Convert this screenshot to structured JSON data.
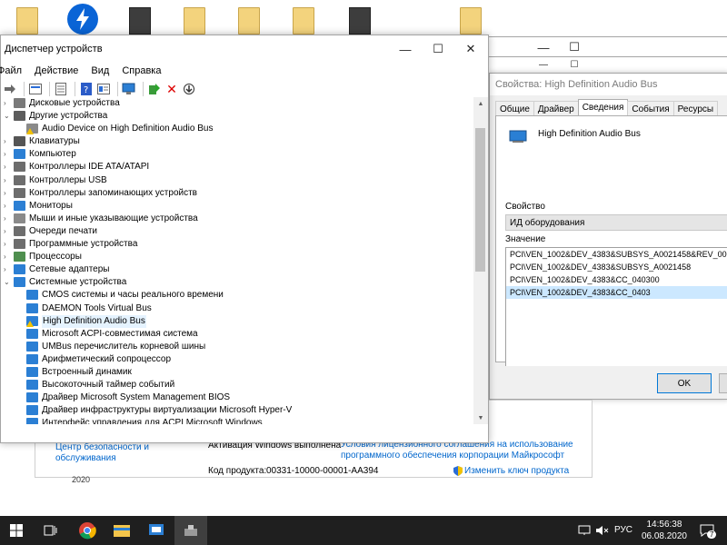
{
  "device_manager": {
    "title": "Диспетчер устройств",
    "menu": [
      "Файл",
      "Действие",
      "Вид",
      "Справка"
    ],
    "tree": [
      {
        "label": "Дисковые устройства",
        "level": 0,
        "state": "collapsed",
        "icon": "disk-icon"
      },
      {
        "label": "Другие устройства",
        "level": 0,
        "state": "expanded",
        "icon": "other-devices-icon"
      },
      {
        "label": "Audio Device on High Definition Audio Bus",
        "level": 1,
        "state": "leaf",
        "icon": "unknown-device-warning-icon"
      },
      {
        "label": "Клавиатуры",
        "level": 0,
        "state": "collapsed",
        "icon": "keyboard-icon"
      },
      {
        "label": "Компьютер",
        "level": 0,
        "state": "collapsed",
        "icon": "computer-icon"
      },
      {
        "label": "Контроллеры IDE ATA/ATAPI",
        "level": 0,
        "state": "collapsed",
        "icon": "ide-controller-icon"
      },
      {
        "label": "Контроллеры USB",
        "level": 0,
        "state": "collapsed",
        "icon": "usb-icon"
      },
      {
        "label": "Контроллеры запоминающих устройств",
        "level": 0,
        "state": "collapsed",
        "icon": "storage-controller-icon"
      },
      {
        "label": "Мониторы",
        "level": 0,
        "state": "collapsed",
        "icon": "monitor-icon"
      },
      {
        "label": "Мыши и иные указывающие устройства",
        "level": 0,
        "state": "collapsed",
        "icon": "mouse-icon"
      },
      {
        "label": "Очереди печати",
        "level": 0,
        "state": "collapsed",
        "icon": "printer-icon"
      },
      {
        "label": "Программные устройства",
        "level": 0,
        "state": "collapsed",
        "icon": "software-device-icon"
      },
      {
        "label": "Процессоры",
        "level": 0,
        "state": "collapsed",
        "icon": "processor-icon"
      },
      {
        "label": "Сетевые адаптеры",
        "level": 0,
        "state": "collapsed",
        "icon": "network-adapter-icon"
      },
      {
        "label": "Системные устройства",
        "level": 0,
        "state": "expanded",
        "icon": "system-device-icon"
      },
      {
        "label": "CMOS системы и часы реального времени",
        "level": 1,
        "state": "leaf",
        "icon": "system-device-icon"
      },
      {
        "label": "DAEMON Tools Virtual Bus",
        "level": 1,
        "state": "leaf",
        "icon": "system-device-icon"
      },
      {
        "label": "High Definition Audio Bus",
        "level": 1,
        "state": "leaf",
        "icon": "system-device-warning-icon",
        "selected": true
      },
      {
        "label": "Microsoft ACPI-совместимая система",
        "level": 1,
        "state": "leaf",
        "icon": "system-device-icon"
      },
      {
        "label": "UMBus перечислитель корневой шины",
        "level": 1,
        "state": "leaf",
        "icon": "system-device-icon"
      },
      {
        "label": "Арифметический сопроцессор",
        "level": 1,
        "state": "leaf",
        "icon": "system-device-icon"
      },
      {
        "label": "Встроенный динамик",
        "level": 1,
        "state": "leaf",
        "icon": "system-device-icon"
      },
      {
        "label": "Высокоточный таймер событий",
        "level": 1,
        "state": "leaf",
        "icon": "system-device-icon"
      },
      {
        "label": "Драйвер Microsoft System Management BIOS",
        "level": 1,
        "state": "leaf",
        "icon": "system-device-icon"
      },
      {
        "label": "Драйвер инфраструктуры виртуализации Microsoft Hyper-V",
        "level": 1,
        "state": "leaf",
        "icon": "system-device-icon"
      },
      {
        "label": "Интерфейс управления для ACPI Microsoft Windows",
        "level": 1,
        "state": "leaf",
        "icon": "system-device-icon"
      }
    ]
  },
  "properties": {
    "title": "Свойства: High Definition Audio Bus",
    "tabs": [
      "Общие",
      "Драйвер",
      "Сведения",
      "События",
      "Ресурсы"
    ],
    "active_tab": "Сведения",
    "device_name": "High Definition Audio Bus",
    "property_label": "Свойство",
    "property_value": "ИД оборудования",
    "value_label": "Значение",
    "values": [
      "PCI\\VEN_1002&DEV_4383&SUBSYS_A0021458&REV_00",
      "PCI\\VEN_1002&DEV_4383&SUBSYS_A0021458",
      "PCI\\VEN_1002&DEV_4383&CC_040300",
      "PCI\\VEN_1002&DEV_4383&CC_0403"
    ],
    "selected_value_index": 3,
    "ok_label": "OK"
  },
  "system_window": {
    "security_link": "Центр безопасности и обслуживания",
    "activation_text": "Активация Windows выполнена",
    "license_link": "Условия лицензионного соглашения на использование программного обеспечения корпорации Майкрософт",
    "product_key_label": "Код продукта:",
    "product_key": "00331-10000-00001-AA394",
    "change_key_link": "Изменить ключ продукта",
    "year_fragment": "2020"
  },
  "taskbar": {
    "language": "РУС",
    "time": "14:56:38",
    "date": "06.08.2020",
    "notification_count": "7"
  },
  "colors": {
    "accent": "#0078d7",
    "link": "#0066cc",
    "selection": "#cce8ff",
    "taskbar": "#1f1f1f",
    "warning": "#f2c200"
  }
}
